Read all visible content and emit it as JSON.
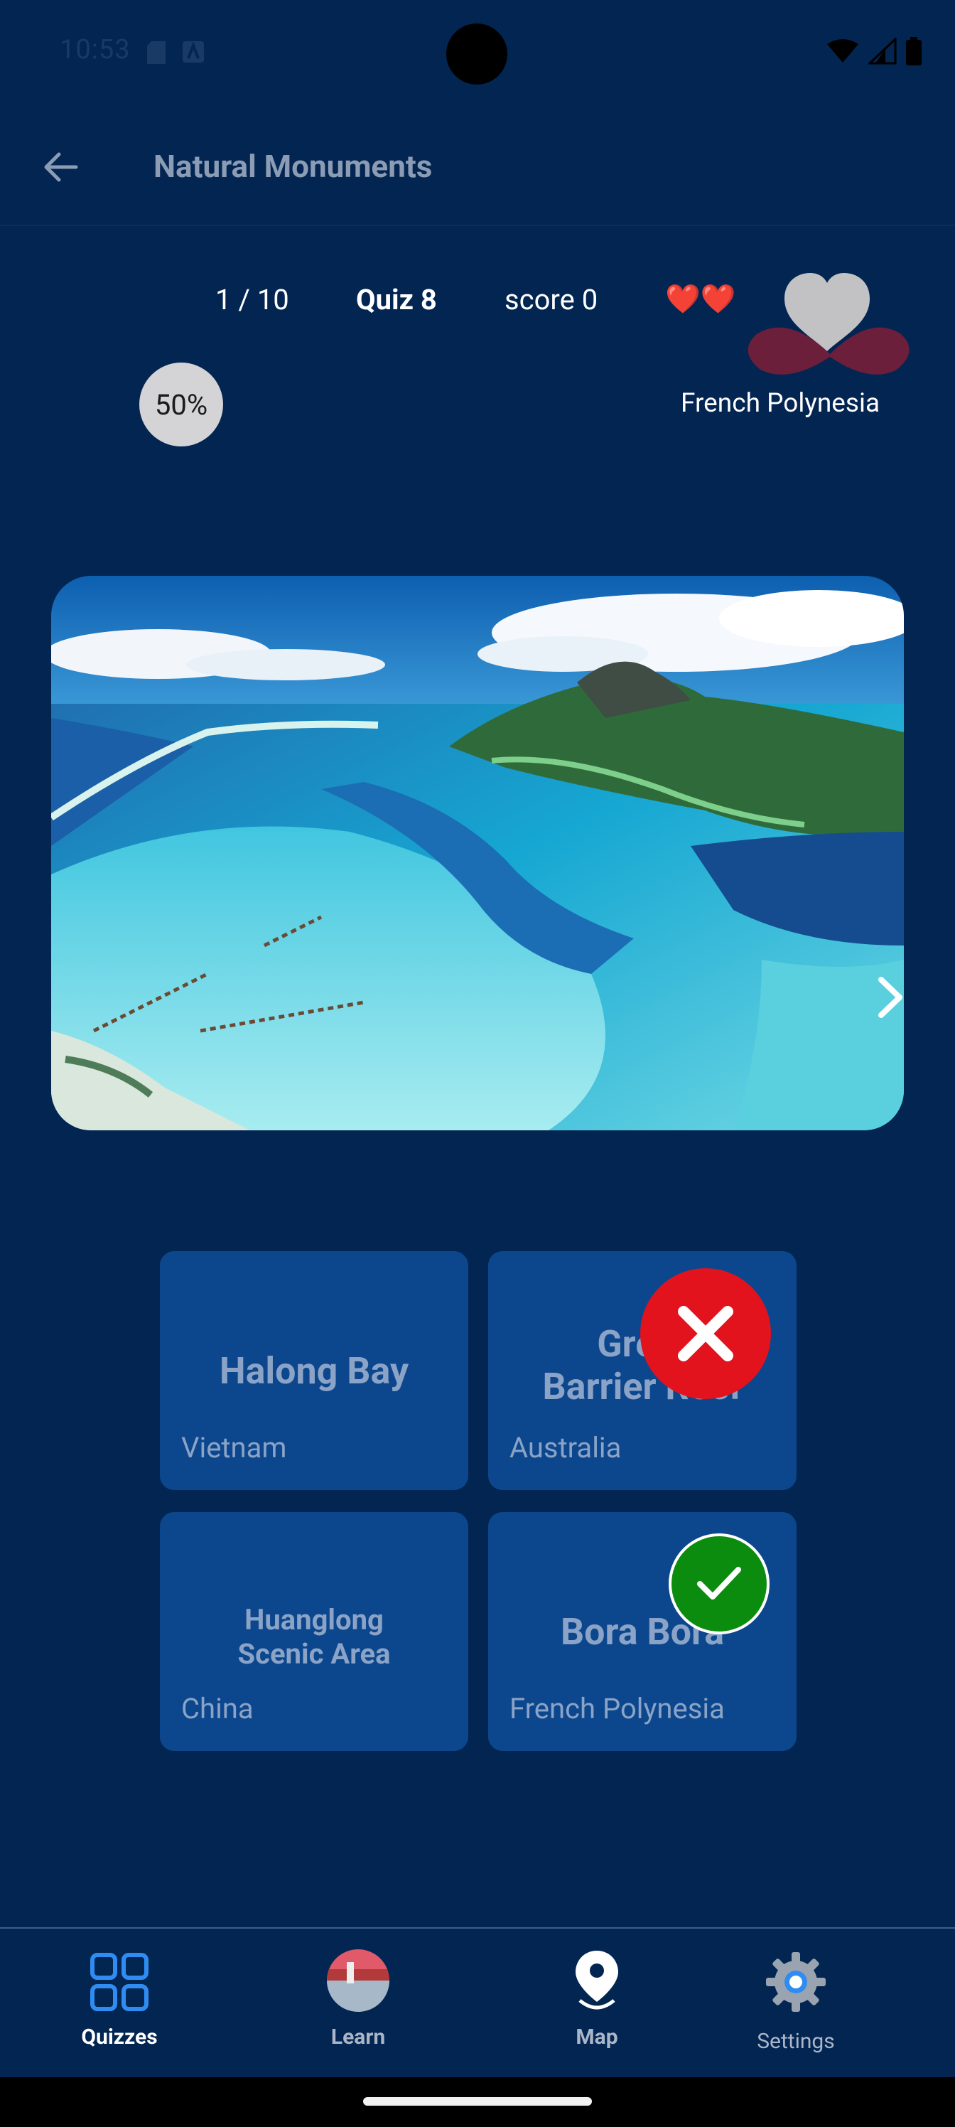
{
  "status_bar": {
    "time": "10:53"
  },
  "app_bar": {
    "title": "Natural Monuments"
  },
  "quiz": {
    "progress": "1 / 10",
    "name": "Quiz 8",
    "score": "score 0",
    "lives": "❤️❤️",
    "fifty_fifty": "50%",
    "answer_hint": "French Polynesia"
  },
  "answers": [
    {
      "title_line1": "Halong Bay",
      "title_line2": "",
      "country": "Vietnam",
      "state": "neutral"
    },
    {
      "title_line1": "Great",
      "title_line2": "Barrier Reef",
      "country": "Australia",
      "state": "wrong"
    },
    {
      "title_line1": "Huanglong",
      "title_line2": "Scenic Area",
      "country": "China",
      "state": "neutral"
    },
    {
      "title_line1": "Bora Bora",
      "title_line2": "",
      "country": "French Polynesia",
      "state": "correct"
    }
  ],
  "bottom_nav": {
    "items": [
      {
        "label": "Quizzes",
        "icon": "grid-icon",
        "active": true
      },
      {
        "label": "Learn",
        "icon": "photo-thumbnail-icon",
        "active": false
      },
      {
        "label": "Map",
        "icon": "map-pin-icon",
        "active": false
      },
      {
        "label": "Settings",
        "icon": "gear-icon",
        "active": false
      }
    ]
  },
  "colors": {
    "background": "#032552",
    "card": "#0c478e",
    "wrong": "#e3131e",
    "correct": "#0c8c0e",
    "active_nav": "#2f8cf0"
  }
}
